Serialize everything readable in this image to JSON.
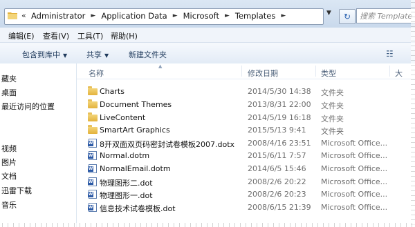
{
  "address": {
    "chevron": "«",
    "crumbs": [
      "Administrator",
      "Application Data",
      "Microsoft",
      "Templates"
    ],
    "search_placeholder": "搜索 Template"
  },
  "menus": [
    "编辑(E)",
    "查看(V)",
    "工具(T)",
    "帮助(H)"
  ],
  "commands": {
    "include_library": "包含到库中",
    "share": "共享",
    "new_folder": "新建文件夹"
  },
  "nav": {
    "items": [
      "藏夹",
      "桌面",
      "最近访问的位置",
      "视频",
      "图片",
      "文档",
      "迅雷下载",
      "音乐"
    ]
  },
  "columns": {
    "name": "名称",
    "date": "修改日期",
    "type": "类型",
    "size": "大"
  },
  "files": [
    {
      "name": "Charts",
      "date": "2014/5/30 14:38",
      "type": "文件夹",
      "icon": "folder-icon"
    },
    {
      "name": "Document Themes",
      "date": "2013/8/31 22:00",
      "type": "文件夹",
      "icon": "folder-icon"
    },
    {
      "name": "LiveContent",
      "date": "2014/5/19 16:18",
      "type": "文件夹",
      "icon": "folder-icon"
    },
    {
      "name": "SmartArt Graphics",
      "date": "2015/5/13 9:41",
      "type": "文件夹",
      "icon": "folder-icon"
    },
    {
      "name": "8开双面双页码密封试卷模板2007.dotx",
      "date": "2008/4/16 23:51",
      "type": "Microsoft Office...",
      "icon": "word-doc-icon"
    },
    {
      "name": "Normal.dotm",
      "date": "2015/6/11 7:57",
      "type": "Microsoft Office...",
      "icon": "word-doc-icon"
    },
    {
      "name": "NormalEmail.dotm",
      "date": "2014/6/5 15:46",
      "type": "Microsoft Office...",
      "icon": "word-doc-icon"
    },
    {
      "name": "物理图形二.dot",
      "date": "2008/2/6 20:22",
      "type": "Microsoft Office...",
      "icon": "word-doc-icon"
    },
    {
      "name": "物理图形一.dot",
      "date": "2008/2/6 20:23",
      "type": "Microsoft Office...",
      "icon": "word-doc-icon"
    },
    {
      "name": "信息技术试卷模板.dot",
      "date": "2008/6/15 21:39",
      "type": "Microsoft Office...",
      "icon": "word-doc-icon"
    }
  ]
}
